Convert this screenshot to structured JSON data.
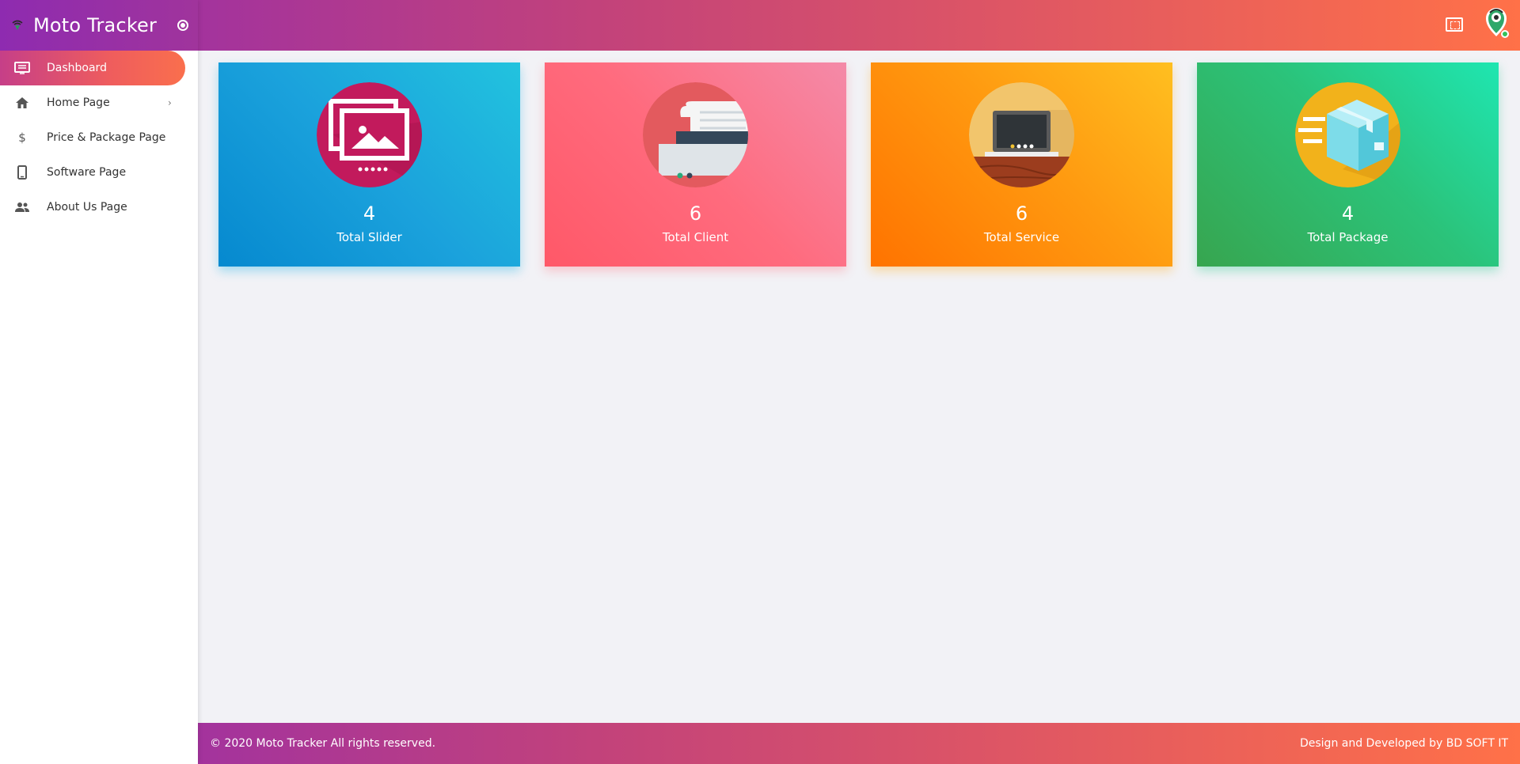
{
  "app": {
    "title": "Moto Tracker"
  },
  "sidebar": {
    "items": [
      {
        "label": "Dashboard",
        "icon": "dashboard-icon",
        "active": true
      },
      {
        "label": "Home Page",
        "icon": "home-icon",
        "has_submenu": true
      },
      {
        "label": "Price & Package Page",
        "icon": "dollar-icon"
      },
      {
        "label": "Software Page",
        "icon": "mobile-icon"
      },
      {
        "label": "About Us Page",
        "icon": "people-icon"
      }
    ]
  },
  "header": {
    "fullscreen_icon": "fullscreen-icon",
    "avatar_icon": "user-avatar-icon"
  },
  "cards": [
    {
      "count": "4",
      "label": "Total Slider",
      "icon": "slider-gallery-icon",
      "color": "#13a9dd"
    },
    {
      "count": "6",
      "label": "Total Client",
      "icon": "printer-client-icon",
      "color": "#ff6877"
    },
    {
      "count": "6",
      "label": "Total Service",
      "icon": "laptop-service-icon",
      "color": "#ff9c12"
    },
    {
      "count": "4",
      "label": "Total Package",
      "icon": "package-box-icon",
      "color": "#2cc67d"
    }
  ],
  "footer": {
    "copyright": "© 2020 Moto Tracker All rights reserved.",
    "credit": "Design and Developed by BD SOFT IT"
  },
  "colors": {
    "header_gradient_start": "#a3339d",
    "header_gradient_end": "#ff7148",
    "active_menu_start": "#c63f88",
    "active_menu_end": "#fa6f4d",
    "background": "#f2f2f6"
  }
}
